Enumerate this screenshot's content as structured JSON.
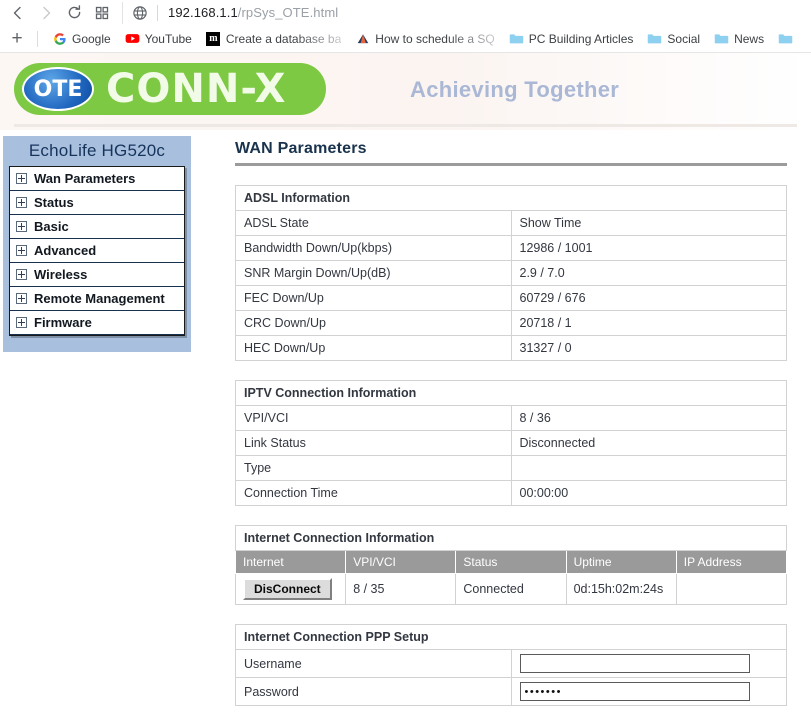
{
  "browser": {
    "nav": {
      "back_icon": "back-arrow-icon",
      "forward_icon": "forward-arrow-icon",
      "reload_icon": "reload-icon",
      "apps_icon": "apps-grid-icon",
      "site_icon": "globe-icon"
    },
    "url": {
      "host": "192.168.1.1",
      "path": "/rpSys_OTE.html"
    },
    "bookmarks": {
      "add_label": "+",
      "items": [
        {
          "label": "Google",
          "icon": "google-icon"
        },
        {
          "label": "YouTube",
          "icon": "youtube-icon"
        },
        {
          "label": "Create a database ba",
          "icon": "metabase-icon"
        },
        {
          "label": "How to schedule a SQ",
          "icon": "triangle-icon"
        },
        {
          "label": "PC Building Articles",
          "icon": "folder-icon"
        },
        {
          "label": "Social",
          "icon": "folder-icon"
        },
        {
          "label": "News",
          "icon": "folder-icon"
        },
        {
          "label": "",
          "icon": "folder-icon"
        }
      ]
    }
  },
  "banner": {
    "brand_badge": "OTE",
    "brand_name": "CONN-X",
    "tagline": "Achieving Together",
    "brand_green": "#7ec943",
    "brand_blue": "#1f66c0",
    "tagline_color": "#aab8d6"
  },
  "sidebar": {
    "title": "EchoLife HG520c",
    "items": [
      {
        "label": "Wan Parameters"
      },
      {
        "label": "Status"
      },
      {
        "label": "Basic"
      },
      {
        "label": "Advanced"
      },
      {
        "label": "Wireless"
      },
      {
        "label": "Remote Management"
      },
      {
        "label": "Firmware"
      }
    ]
  },
  "main": {
    "page_title": "WAN Parameters",
    "adsl": {
      "heading": "ADSL Information",
      "rows": [
        {
          "label": "ADSL State",
          "value": "Show Time",
          "style": "showtime"
        },
        {
          "label": "Bandwidth Down/Up(kbps)",
          "value": "12986 / 1001"
        },
        {
          "label": "SNR Margin Down/Up(dB)",
          "value": "2.9 / 7.0"
        },
        {
          "label": "FEC  Down/Up",
          "value": "60729 / 676"
        },
        {
          "label": "CRC Down/Up",
          "value": "20718 / 1"
        },
        {
          "label": "HEC Down/Up",
          "value": "31327 / 0"
        }
      ]
    },
    "iptv": {
      "heading": "IPTV Connection Information",
      "rows": [
        {
          "label": "VPI/VCI",
          "value": "8 / 36"
        },
        {
          "label": "Link Status",
          "value": "Disconnected"
        },
        {
          "label": "Type",
          "value": ""
        },
        {
          "label": "Connection Time",
          "value": "00:00:00"
        }
      ]
    },
    "internet": {
      "heading": "Internet Connection Information",
      "columns": [
        "Internet",
        "VPI/VCI",
        "Status",
        "Uptime",
        "IP Address"
      ],
      "row": {
        "button_label": "DisConnect",
        "vpi_vci": "8 / 35",
        "status": "Connected",
        "uptime": "0d:15h:02m:24s",
        "ip_address": ""
      }
    },
    "ppp": {
      "heading": "Internet Connection PPP Setup",
      "username_label": "Username",
      "username_value": "",
      "password_label": "Password",
      "password_value": "•••••••"
    }
  }
}
